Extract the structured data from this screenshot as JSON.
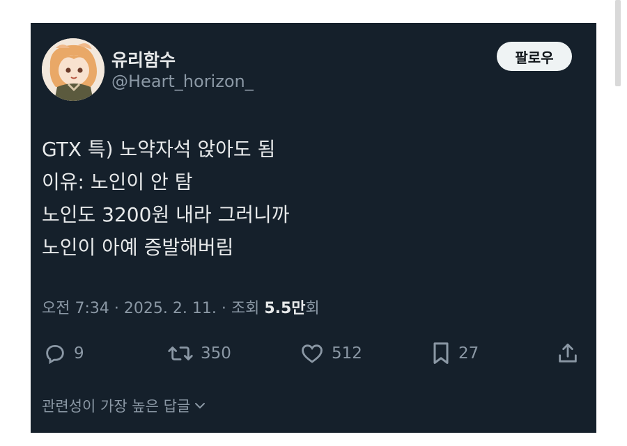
{
  "author": {
    "display_name": "유리함수",
    "handle": "@Heart_horizon_",
    "avatar_icon": "anime-character-avatar"
  },
  "follow_button": {
    "label": "팔로우"
  },
  "tweet": {
    "lines": [
      "GTX 특) 노약자석 앉아도 됨",
      "이유: 노인이 안 탐",
      "노인도 3200원 내라 그러니까",
      "노인이 아예 증발해버림"
    ]
  },
  "meta": {
    "time": "오전 7:34",
    "date": "2025. 2. 11.",
    "views_label": "조회",
    "views_value": "5.5만",
    "views_suffix": "회"
  },
  "actions": {
    "reply": {
      "icon": "reply-icon",
      "count": "9"
    },
    "retweet": {
      "icon": "retweet-icon",
      "count": "350"
    },
    "like": {
      "icon": "heart-icon",
      "count": "512"
    },
    "bookmark": {
      "icon": "bookmark-icon",
      "count": "27"
    },
    "share": {
      "icon": "share-icon"
    }
  },
  "replies_sort": {
    "label": "관련성이 가장 높은 답글"
  },
  "colors": {
    "card_bg": "#15202b",
    "primary_text": "#e7e9ea",
    "secondary_text": "#8b98a5",
    "follow_bg": "#eff3f4"
  }
}
